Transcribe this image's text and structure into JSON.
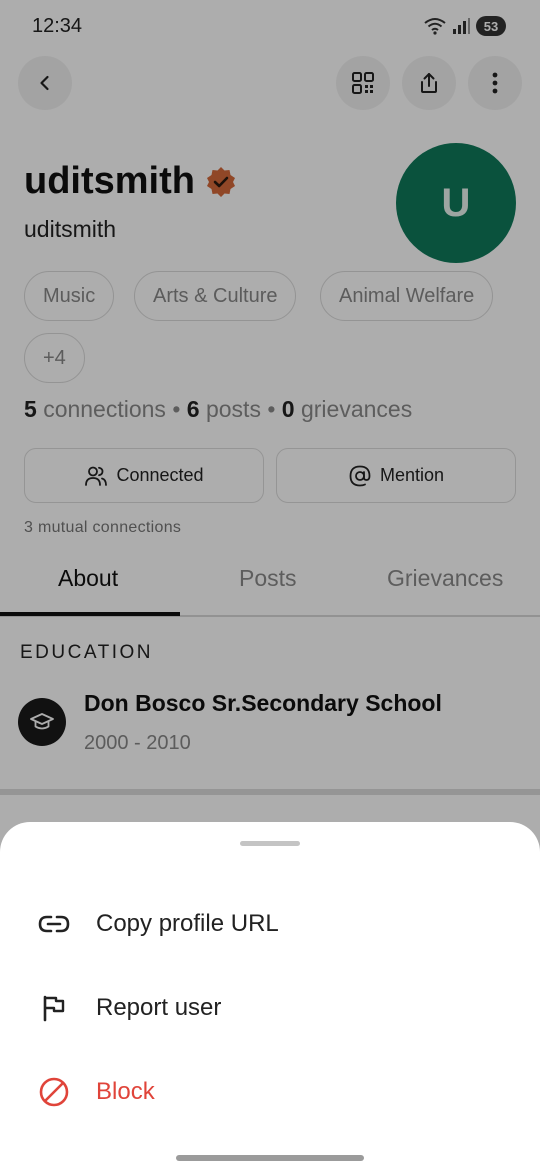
{
  "status_bar": {
    "time": "12:34",
    "battery": "53"
  },
  "profile": {
    "display_name": "uditsmith",
    "username": "uditsmith",
    "avatar_initial": "U",
    "interests": [
      "Music",
      "Arts & Culture",
      "Animal Welfare"
    ],
    "more_interests": "+4",
    "stats": {
      "connections_count": "5",
      "connections_label": "connections",
      "posts_count": "6",
      "posts_label": "posts",
      "grievances_count": "0",
      "grievances_label": "grievances",
      "separator": "•"
    },
    "connected_label": "Connected",
    "mention_label": "Mention",
    "mutual": "3 mutual connections"
  },
  "tabs": [
    {
      "label": "About",
      "active": true
    },
    {
      "label": "Posts",
      "active": false
    },
    {
      "label": "Grievances",
      "active": false
    }
  ],
  "about": {
    "education_heading": "EDUCATION",
    "school": "Don Bosco Sr.Secondary School",
    "years": "2000 - 2010"
  },
  "sheet": {
    "items": [
      {
        "label": "Copy profile URL",
        "icon": "link-icon"
      },
      {
        "label": "Report user",
        "icon": "flag-icon"
      },
      {
        "label": "Block",
        "icon": "block-icon",
        "danger": true
      }
    ]
  },
  "colors": {
    "avatar": "#0f7a5a",
    "verified": "#d4693a",
    "danger": "#e0443a"
  }
}
